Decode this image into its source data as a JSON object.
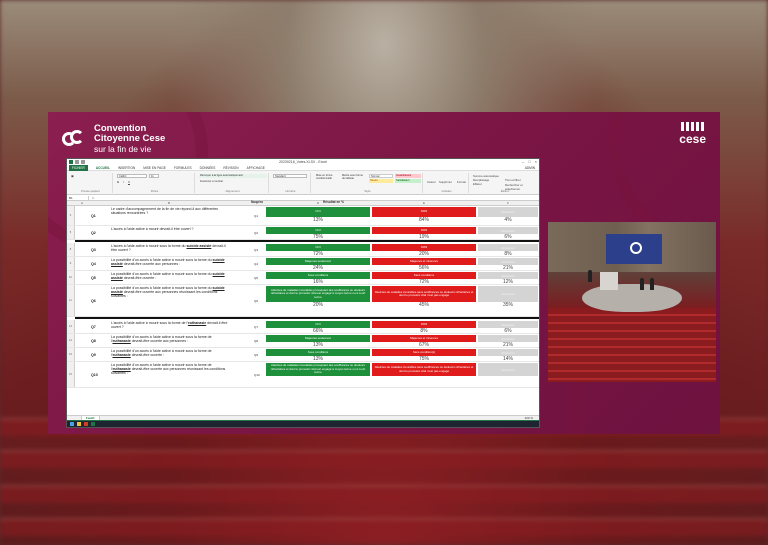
{
  "brand": {
    "line1": "Convention",
    "line2": "Citoyenne Cese",
    "line3": "sur la fin de vie",
    "right_logo": "cese"
  },
  "excel": {
    "window_title": "20230216_Votes.XLSX - Excel",
    "menu": [
      "FICHIER",
      "ACCUEIL",
      "INSERTION",
      "MISE EN PAGE",
      "FORMULES",
      "DONNÉES",
      "RÉVISION",
      "AFFICHAGE"
    ],
    "active_menu": "ACCUEIL",
    "ribbon": {
      "clipboard_label": "Presse-papiers",
      "font_label": "Police",
      "alignment_label": "Alignement",
      "number_label": "Nombre",
      "styles_label": "Style",
      "cells_label": "Cellules",
      "editing_label": "Édition",
      "font_name": "Calibri",
      "font_size": "11",
      "wrap_text": "Renvoyer à la ligne automatiquement",
      "merge_center": "Fusionner et centrer",
      "number_format": "Standard",
      "cond_format": "Mise en forme conditionnelle",
      "table_format": "Mettre sous forme de tableau",
      "style_normal": "Normal",
      "style_insat": "Insatisfaisant",
      "style_neutre": "Neutre",
      "style_satisf": "Satisfaisant",
      "insert": "Insérer",
      "delete": "Supprimer",
      "format": "Format",
      "autosum": "Somme automatique",
      "fill": "Remplissage",
      "clear": "Effacer",
      "sort": "Trier et filtrer",
      "find": "Rechercher et sélectionner",
      "user": "ADMIN"
    },
    "name_box": "B1",
    "columns": [
      "A",
      "B",
      "C",
      "D",
      "E",
      "F"
    ],
    "header_votes": "Numéro",
    "header_result": "Résultat en %",
    "rows": [
      {
        "num": "3",
        "id": "Q1",
        "code": "Q1",
        "text": "Le cadre d'accompagnement de la fin de vie répond-il aux différentes situations rencontrées ?",
        "green_label": "OUI",
        "red_label": "NON",
        "grey_label": "Abstention",
        "green_pct": "13%",
        "red_pct": "84%",
        "grey_pct": "4%"
      },
      {
        "num": "5",
        "id": "Q2",
        "code": "Q2",
        "text": "L'accès à l'aide active à mourir devrait-il être ouvert ?",
        "green_label": "OUI",
        "red_label": "NON",
        "grey_label": "Abstention",
        "green_pct": "75%",
        "red_pct": "19%",
        "grey_pct": "6%"
      },
      {
        "num": "8",
        "id": "Q3",
        "code": "Q3",
        "text_pre": "L'accès à l'aide active à mourir sous la forme du ",
        "text_u": "suicide assisté",
        "text_post": " devrait-il être ouvert ?",
        "green_label": "OUI",
        "red_label": "NON",
        "grey_label": "Abstention",
        "green_pct": "72%",
        "red_pct": "20%",
        "grey_pct": "8%"
      },
      {
        "num": "9",
        "id": "Q4",
        "code": "Q4",
        "text_pre": "La possibilité d'un accès à l'aide active à mourir sous la forme du ",
        "text_u": "suicide assisté",
        "text_post": " devrait-être ouverte aux personnes :",
        "green_label": "Majeures seulement",
        "red_label": "Majeures et mineures",
        "grey_label": "Abstention",
        "green_pct": "24%",
        "red_pct": "56%",
        "grey_pct": "21%"
      },
      {
        "num": "10",
        "id": "Q5",
        "code": "Q5",
        "text_pre": "La possibilité d'un accès à l'aide active à mourir sous la forme du ",
        "text_u": "suicide assisté",
        "text_post": " devrait-être ouverte :",
        "green_label": "Sous conditions",
        "red_label": "Sans conditions",
        "grey_label": "Abstention",
        "green_pct": "16%",
        "red_pct": "72%",
        "grey_pct": "12%"
      },
      {
        "num": "11",
        "id": "Q6",
        "code": "Q6",
        "text_pre": "La possibilité d'un accès à l'aide active à mourir sous la forme du ",
        "text_u": "suicide assisté",
        "text_post": " devrait-être ouverte aux personnes réunissant les conditions suivantes :",
        "green_label": "Atteintes de maladies incurables provoquant des souffrances ou douleurs réfractaires et dont le pronostic vital est engagé à moyen terme ou à court terme",
        "red_label": "Atteintes de maladies incurables sans souffrances ou douleurs réfractaires et dont le pronostic vital n'est pas engagé",
        "grey_label": "Abstention",
        "green_pct": "20%",
        "red_pct": "45%",
        "grey_pct": "35%"
      },
      {
        "num": "13",
        "id": "Q7",
        "code": "Q7",
        "text_pre": "L'accès à l'aide active à mourir sous la forme de l'",
        "text_u": "euthanasie",
        "text_post": " devrait-il être ouvert ?",
        "green_label": "OUI",
        "red_label": "NON",
        "grey_label": "Abstention",
        "green_pct": "66%",
        "red_pct": "8%",
        "grey_pct": "6%"
      },
      {
        "num": "14",
        "id": "Q8",
        "code": "Q8",
        "text_pre": "La possibilité d'un accès à l'aide active à mourir sous la forme de l'",
        "text_u": "euthanasie",
        "text_post": " devrait-être ouverte aux personnes :",
        "green_label": "Majeures seulement",
        "red_label": "Majeures et mineures",
        "grey_label": "Abstention",
        "green_pct": "13%",
        "red_pct": "67%",
        "grey_pct": "21%"
      },
      {
        "num": "15",
        "id": "Q9",
        "code": "Q9",
        "text_pre": "La possibilité d'un accès à l'aide active à mourir sous la forme de l'",
        "text_u": "euthanasie",
        "text_post": " devrait-être ouverte :",
        "green_label": "Sous conditions",
        "red_label": "Sans condition(s)",
        "grey_label": "Abstention",
        "green_pct": "13%",
        "red_pct": "75%",
        "grey_pct": "14%"
      },
      {
        "num": "16",
        "id": "Q10",
        "code": "Q10",
        "text_pre": "La possibilité d'un accès à l'aide active à mourir sous la forme de l'",
        "text_u": "euthanasie",
        "text_post": " devrait-être ouverte aux personnes réunissant les conditions suivantes :",
        "green_label": "Atteintes de maladies incurables provoquant des souffrances ou douleurs réfractaires et dont le pronostic vital est engagé à moyen terme ou à court terme",
        "red_label": "Atteintes de maladies incurables sans souffrances ou douleurs réfractaires et dont le pronostic vital n'est pas engagé",
        "grey_label": "Abstention",
        "green_pct": "",
        "red_pct": "",
        "grey_pct": ""
      }
    ],
    "sheet_tab": "Feuil1",
    "zoom": "100 %"
  },
  "colors": {
    "panel": "#7a1544",
    "green": "#1e8f3a",
    "red": "#e01b1b",
    "grey": "#d4d4d4",
    "excel_green": "#217346"
  }
}
